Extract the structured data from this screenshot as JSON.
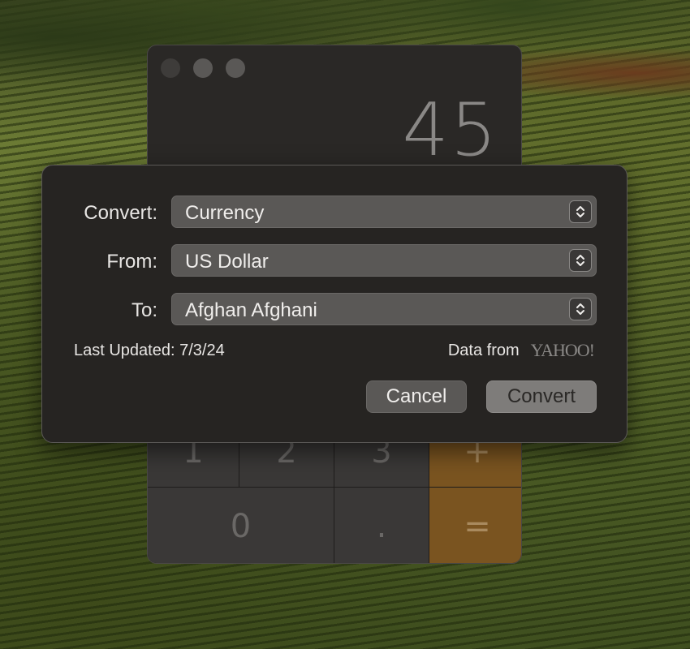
{
  "calculator": {
    "display": "45",
    "keys_top": [
      "1",
      "2",
      "3",
      "+"
    ],
    "keys_bottom": [
      "0",
      ".",
      "="
    ]
  },
  "dialog": {
    "convert_label": "Convert:",
    "convert_value": "Currency",
    "from_label": "From:",
    "from_value": "US Dollar",
    "to_label": "To:",
    "to_value": "Afghan Afghani",
    "last_updated": "Last Updated: 7/3/24",
    "data_from": "Data from",
    "provider": "YAHOO!",
    "cancel_label": "Cancel",
    "convert_button_label": "Convert"
  },
  "colors": {
    "operator_key": "#7a5420",
    "dialog_bg": "#262422",
    "popup_bg": "#5a5856"
  }
}
